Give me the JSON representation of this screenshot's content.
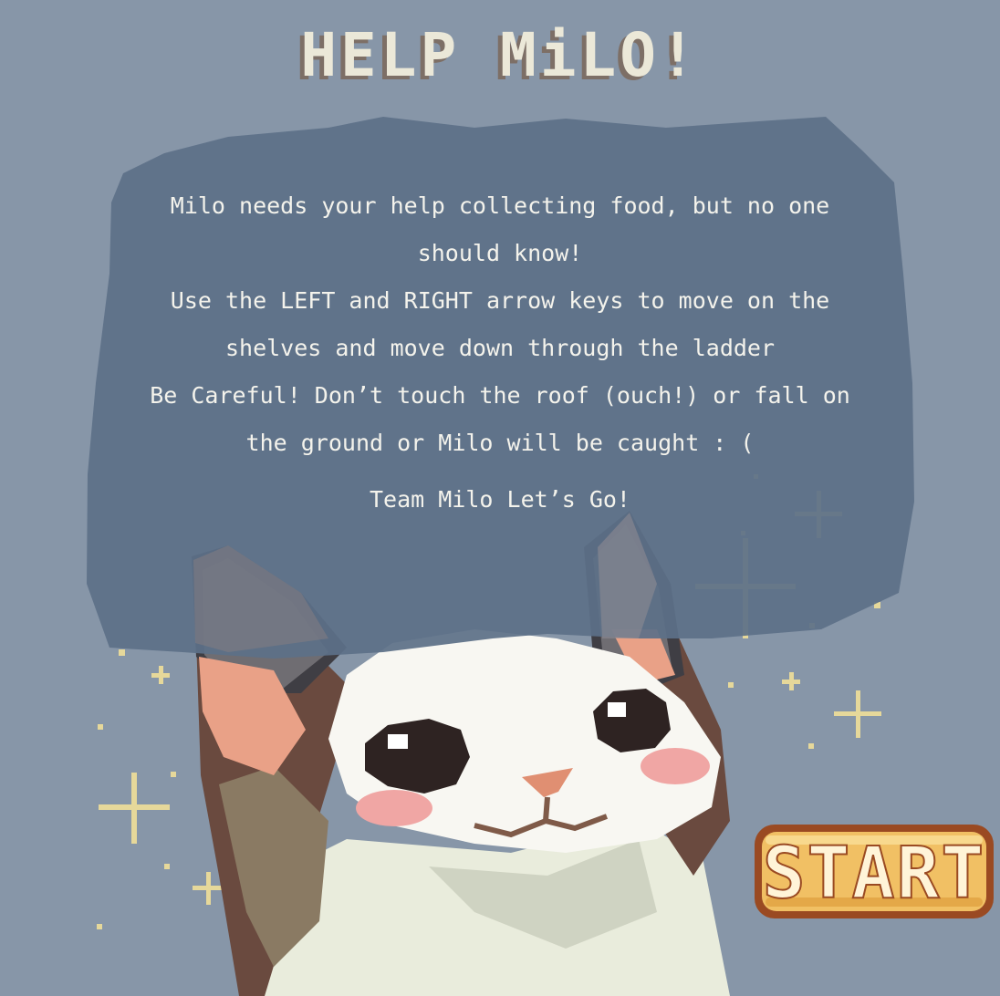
{
  "game": {
    "title": "HELP MiLO!",
    "instructions": [
      "Milo needs your help collecting food, but no one should know!",
      "Use the LEFT and RIGHT arrow keys to move on the shelves and move down through the ladder",
      "Be Careful! Don’t touch the roof (ouch!) or fall on the ground or Milo will be caught : (",
      "Team Milo Let’s Go!"
    ],
    "start_label": "START"
  },
  "colors": {
    "background": "#8796a8",
    "panel": "#5c7088",
    "title_text": "#ebe8d8",
    "title_shadow": "#7d6f66",
    "sparkle": "#e6d89a",
    "button_fill": "#f1c064",
    "button_border": "#9a4a22"
  },
  "icons": [
    "cat-character",
    "sparkle-icon"
  ]
}
